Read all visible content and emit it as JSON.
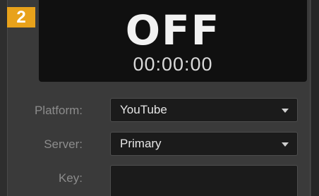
{
  "step_badge": "2",
  "display": {
    "status": "OFF",
    "timecode": "00:00:00"
  },
  "form": {
    "platform": {
      "label": "Platform:",
      "value": "YouTube",
      "icon": "chevron-down-icon"
    },
    "server": {
      "label": "Server:",
      "value": "Primary",
      "icon": "chevron-down-icon"
    },
    "key": {
      "label": "Key:",
      "value": ""
    }
  },
  "colors": {
    "badge": "#e8a21b",
    "display_bg": "#101010",
    "panel_bg": "#3a3a3a",
    "field_bg": "#1b1b1b",
    "label_text": "#8c8c8c",
    "value_text": "#e6e6e6"
  }
}
